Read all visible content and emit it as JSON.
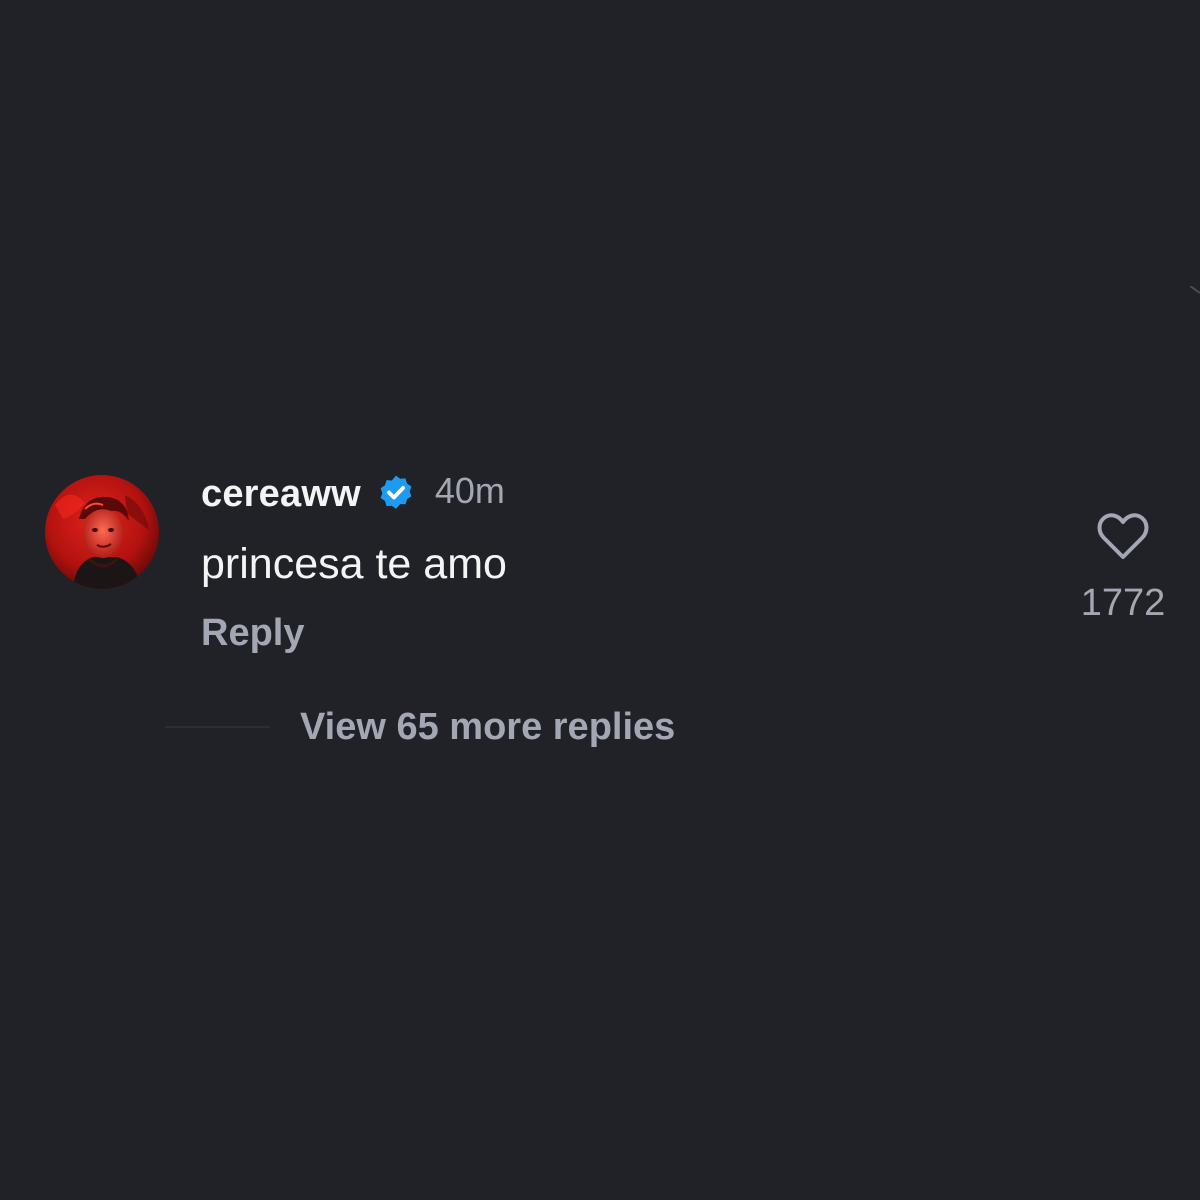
{
  "comment": {
    "username": "cereaww",
    "verified": true,
    "timestamp": "40m",
    "text": "princesa te amo",
    "reply_label": "Reply",
    "view_replies_label": "View 65 more replies",
    "like_count": "1772",
    "liked": false
  },
  "icons": {
    "verified": "verified-badge-icon",
    "like": "heart-outline-icon",
    "avatar": "user-avatar"
  },
  "colors": {
    "background": "#212227",
    "primary_text": "#f3f4f6",
    "secondary_text": "#a2a7b3",
    "verified_blue": "#1d9bf0"
  }
}
